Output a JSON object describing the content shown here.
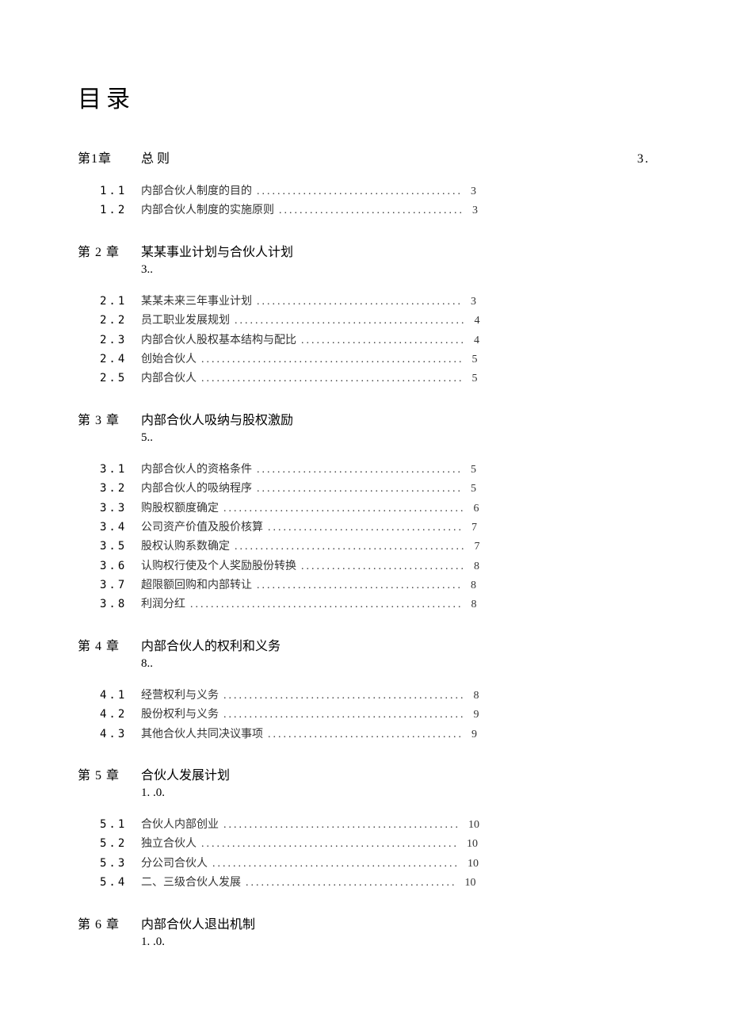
{
  "title": "目录",
  "chapters": [
    {
      "label": "第1章",
      "name": "总 则",
      "dots_to_edge": true,
      "page": "3.",
      "note": "",
      "sections": [
        {
          "num": "1.1",
          "name": "内部合伙人制度的目的",
          "page": "3"
        },
        {
          "num": "1.2",
          "name": "内部合伙人制度的实施原则",
          "page": "3"
        }
      ]
    },
    {
      "label": "第 2 章",
      "name": "某某事业计划与合伙人计划",
      "dots_to_edge": false,
      "page": "",
      "note": "3..",
      "sections": [
        {
          "num": "2.1",
          "name": "某某未来三年事业计划",
          "page": "3"
        },
        {
          "num": "2.2",
          "name": "员工职业发展规划",
          "page": "4"
        },
        {
          "num": "2.3",
          "name": "内部合伙人股权基本结构与配比",
          "page": "4"
        },
        {
          "num": "2.4",
          "name": "创始合伙人",
          "page": "5"
        },
        {
          "num": "2.5",
          "name": "内部合伙人",
          "page": "5"
        }
      ]
    },
    {
      "label": "第 3 章",
      "name": "内部合伙人吸纳与股权激励",
      "dots_to_edge": false,
      "page": "",
      "note": "5..",
      "sections": [
        {
          "num": "3.1",
          "name": "内部合伙人的资格条件",
          "page": "5"
        },
        {
          "num": "3.2",
          "name": "内部合伙人的吸纳程序",
          "page": "5"
        },
        {
          "num": "3.3",
          "name": "购股权额度确定",
          "page": "6"
        },
        {
          "num": "3.4",
          "name": "公司资产价值及股价核算",
          "page": "7"
        },
        {
          "num": "3.5",
          "name": "股权认购系数确定",
          "page": "7"
        },
        {
          "num": "3.6",
          "name": "认购权行使及个人奖励股份转换",
          "page": "8"
        },
        {
          "num": "3.7",
          "name": "超限额回购和内部转让",
          "page": "8"
        },
        {
          "num": "3.8",
          "name": "利润分红",
          "page": "8"
        }
      ]
    },
    {
      "label": "第 4 章",
      "name": "内部合伙人的权利和义务",
      "dots_to_edge": false,
      "page": "",
      "note": "8..",
      "sections": [
        {
          "num": "4.1",
          "name": "经营权利与义务",
          "page": "8"
        },
        {
          "num": "4.2",
          "name": "股份权利与义务",
          "page": "9"
        },
        {
          "num": "4.3",
          "name": "其他合伙人共同决议事项",
          "page": "9"
        }
      ]
    },
    {
      "label": "第 5 章",
      "name": "合伙人发展计划",
      "dots_to_edge": false,
      "page": "",
      "note": "1. .0.",
      "sections": [
        {
          "num": "5.1",
          "name": "合伙人内部创业",
          "page": "10"
        },
        {
          "num": "5.2",
          "name": "独立合伙人",
          "page": "10"
        },
        {
          "num": "5.3",
          "name": "分公司合伙人",
          "page": "10"
        },
        {
          "num": "5.4",
          "name": "二、三级合伙人发展",
          "page": "10"
        }
      ]
    },
    {
      "label": "第 6 章",
      "name": "内部合伙人退出机制",
      "dots_to_edge": false,
      "page": "",
      "note": "1. .0.",
      "sections": []
    }
  ]
}
